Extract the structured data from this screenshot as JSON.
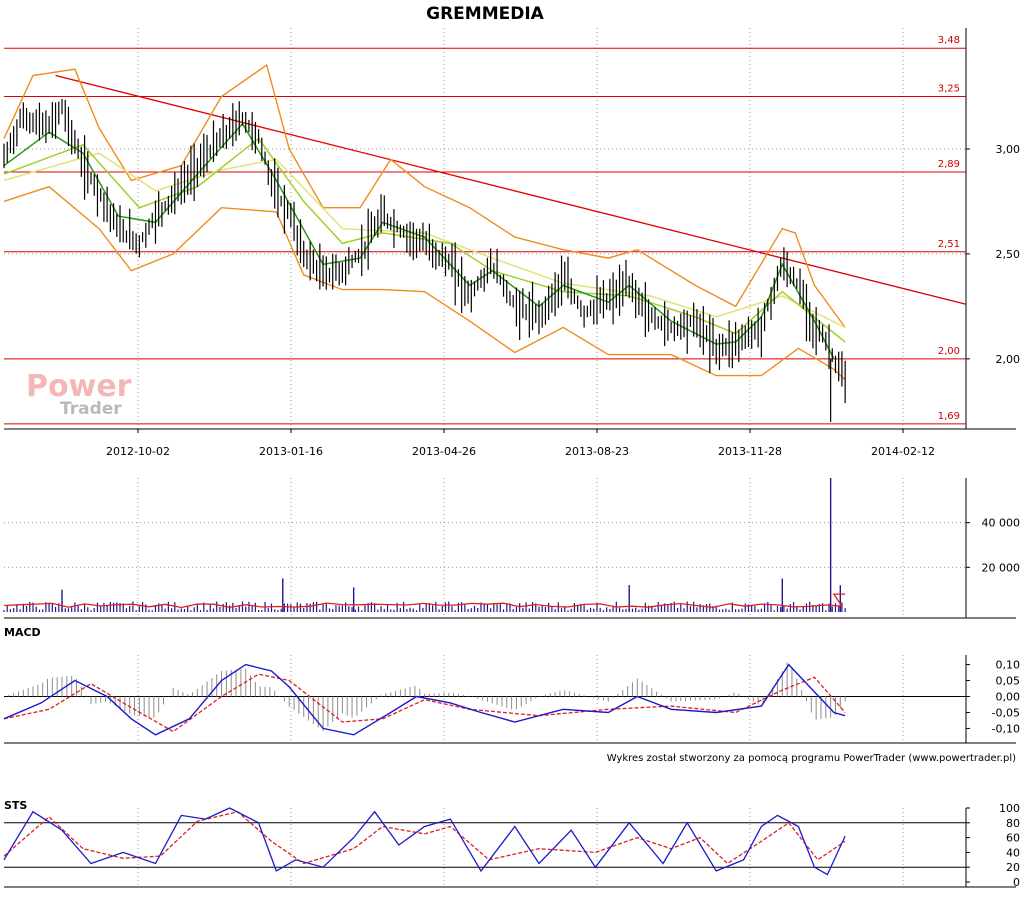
{
  "title": "GREMMEDIA",
  "footer": "Wykres został stworzony za pomocą programu PowerTrader (www.powertrader.pl)",
  "watermark": {
    "line1": "Power",
    "line2": "Trader"
  },
  "colors": {
    "candles": "#000000",
    "levels": "#dd0000",
    "trendline": "#dd0000",
    "bollinger": "#f08c1e",
    "ma_fast": "#2a9a18",
    "ma_mid": "#9fd02c",
    "ma_slow": "#e2e27a",
    "volume_bars": "#1a1a8c",
    "volume_ma": "#e02020",
    "macd_line": "#1a1acc",
    "macd_signal": "#dd2020",
    "macd_hist": "#8c8c8c",
    "sts_k": "#1a1acc",
    "sts_d": "#dd2020",
    "grid": "#999999"
  },
  "chart_data": [
    {
      "type": "candlestick",
      "name": "price",
      "title": "GREMMEDIA",
      "x_tick_labels": [
        "2012-10-02",
        "2013-01-16",
        "2013-04-26",
        "2013-08-23",
        "2013-11-28",
        "2014-02-12"
      ],
      "y_tick_labels": [
        "3,00",
        "2,50",
        "2,00"
      ],
      "ylim": [
        1.68,
        3.5
      ],
      "xlim": [
        "2012-07-23",
        "2014-03-12"
      ],
      "horizontal_levels": [
        {
          "label": "3,48",
          "value": 3.48
        },
        {
          "label": "3,25",
          "value": 3.25
        },
        {
          "label": "2,89",
          "value": 2.89
        },
        {
          "label": "2,51",
          "value": 2.51
        },
        {
          "label": "2,00",
          "value": 2.0
        },
        {
          "label": "1,69",
          "value": 1.69
        }
      ],
      "trendline": {
        "from": {
          "x": "2012-08-24",
          "y": 3.35
        },
        "to": {
          "x": "2014-03-12",
          "y": 2.26
        }
      },
      "price_path": [
        [
          "2012-07-23",
          2.95
        ],
        [
          "2012-08-03",
          3.15
        ],
        [
          "2012-08-20",
          3.1
        ],
        [
          "2012-08-28",
          3.2
        ],
        [
          "2012-09-10",
          2.92
        ],
        [
          "2012-09-20",
          2.8
        ],
        [
          "2012-10-02",
          2.62
        ],
        [
          "2012-10-15",
          2.55
        ],
        [
          "2012-10-25",
          2.68
        ],
        [
          "2012-11-08",
          2.8
        ],
        [
          "2012-11-20",
          2.92
        ],
        [
          "2012-12-05",
          3.05
        ],
        [
          "2012-12-18",
          3.15
        ],
        [
          "2012-12-28",
          3.05
        ],
        [
          "2013-01-08",
          2.78
        ],
        [
          "2013-01-16",
          2.7
        ],
        [
          "2013-01-25",
          2.5
        ],
        [
          "2013-02-06",
          2.4
        ],
        [
          "2013-02-18",
          2.42
        ],
        [
          "2013-03-01",
          2.5
        ],
        [
          "2013-03-15",
          2.68
        ],
        [
          "2013-03-28",
          2.6
        ],
        [
          "2013-04-10",
          2.55
        ],
        [
          "2013-04-26",
          2.45
        ],
        [
          "2013-05-08",
          2.3
        ],
        [
          "2013-05-22",
          2.45
        ],
        [
          "2013-06-05",
          2.25
        ],
        [
          "2013-06-20",
          2.2
        ],
        [
          "2013-07-05",
          2.38
        ],
        [
          "2013-07-18",
          2.22
        ],
        [
          "2013-08-02",
          2.28
        ],
        [
          "2013-08-15",
          2.35
        ],
        [
          "2013-08-28",
          2.2
        ],
        [
          "2013-09-10",
          2.15
        ],
        [
          "2013-09-25",
          2.18
        ],
        [
          "2013-10-08",
          2.05
        ],
        [
          "2013-10-20",
          2.08
        ],
        [
          "2013-11-05",
          2.15
        ],
        [
          "2013-11-18",
          2.45
        ],
        [
          "2013-11-28",
          2.35
        ],
        [
          "2013-12-08",
          2.15
        ],
        [
          "2013-12-16",
          2.08
        ],
        [
          "2013-12-20",
          2.0
        ],
        [
          "2013-12-27",
          1.88
        ]
      ],
      "moving_average_fast": [
        [
          "2012-07-23",
          2.92
        ],
        [
          "2012-08-20",
          3.08
        ],
        [
          "2012-09-10",
          2.98
        ],
        [
          "2012-10-02",
          2.68
        ],
        [
          "2012-10-25",
          2.65
        ],
        [
          "2012-11-20",
          2.88
        ],
        [
          "2012-12-18",
          3.12
        ],
        [
          "2013-01-08",
          2.85
        ],
        [
          "2013-02-06",
          2.45
        ],
        [
          "2013-03-01",
          2.48
        ],
        [
          "2013-03-15",
          2.65
        ],
        [
          "2013-04-10",
          2.58
        ],
        [
          "2013-05-08",
          2.35
        ],
        [
          "2013-05-22",
          2.42
        ],
        [
          "2013-06-20",
          2.25
        ],
        [
          "2013-07-05",
          2.35
        ],
        [
          "2013-08-02",
          2.27
        ],
        [
          "2013-08-15",
          2.35
        ],
        [
          "2013-09-10",
          2.18
        ],
        [
          "2013-10-08",
          2.07
        ],
        [
          "2013-10-20",
          2.08
        ],
        [
          "2013-11-05",
          2.2
        ],
        [
          "2013-11-18",
          2.45
        ],
        [
          "2013-12-08",
          2.18
        ],
        [
          "2013-12-20",
          2.0
        ]
      ],
      "moving_average_mid": [
        [
          "2012-07-23",
          2.88
        ],
        [
          "2012-09-10",
          3.02
        ],
        [
          "2012-10-15",
          2.72
        ],
        [
          "2012-11-20",
          2.82
        ],
        [
          "2012-12-28",
          3.05
        ],
        [
          "2013-01-25",
          2.75
        ],
        [
          "2013-02-18",
          2.55
        ],
        [
          "2013-03-15",
          2.6
        ],
        [
          "2013-04-26",
          2.55
        ],
        [
          "2013-05-22",
          2.42
        ],
        [
          "2013-07-05",
          2.32
        ],
        [
          "2013-08-15",
          2.3
        ],
        [
          "2013-09-25",
          2.2
        ],
        [
          "2013-10-20",
          2.12
        ],
        [
          "2013-11-18",
          2.32
        ],
        [
          "2013-12-27",
          2.08
        ]
      ],
      "moving_average_slow": [
        [
          "2012-07-23",
          2.85
        ],
        [
          "2012-09-20",
          2.98
        ],
        [
          "2012-10-25",
          2.8
        ],
        [
          "2012-12-05",
          2.9
        ],
        [
          "2013-01-08",
          2.95
        ],
        [
          "2013-02-18",
          2.62
        ],
        [
          "2013-04-10",
          2.6
        ],
        [
          "2013-05-22",
          2.48
        ],
        [
          "2013-07-05",
          2.36
        ],
        [
          "2013-08-28",
          2.3
        ],
        [
          "2013-10-08",
          2.2
        ],
        [
          "2013-11-18",
          2.3
        ],
        [
          "2013-12-27",
          2.15
        ]
      ],
      "bollinger_upper": [
        [
          "2012-07-23",
          3.05
        ],
        [
          "2012-08-10",
          3.35
        ],
        [
          "2012-09-05",
          3.38
        ],
        [
          "2012-09-20",
          3.1
        ],
        [
          "2012-10-10",
          2.85
        ],
        [
          "2012-11-10",
          2.92
        ],
        [
          "2012-12-05",
          3.25
        ],
        [
          "2013-01-02",
          3.4
        ],
        [
          "2013-01-16",
          3.0
        ],
        [
          "2013-02-06",
          2.72
        ],
        [
          "2013-03-01",
          2.72
        ],
        [
          "2013-03-20",
          2.95
        ],
        [
          "2013-04-10",
          2.82
        ],
        [
          "2013-05-08",
          2.72
        ],
        [
          "2013-06-05",
          2.58
        ],
        [
          "2013-07-05",
          2.52
        ],
        [
          "2013-08-02",
          2.48
        ],
        [
          "2013-08-20",
          2.52
        ],
        [
          "2013-09-25",
          2.35
        ],
        [
          "2013-10-20",
          2.25
        ],
        [
          "2013-11-18",
          2.62
        ],
        [
          "2013-11-26",
          2.6
        ],
        [
          "2013-12-08",
          2.35
        ],
        [
          "2013-12-27",
          2.15
        ]
      ],
      "bollinger_lower": [
        [
          "2012-07-23",
          2.75
        ],
        [
          "2012-08-20",
          2.82
        ],
        [
          "2012-09-20",
          2.62
        ],
        [
          "2012-10-10",
          2.42
        ],
        [
          "2012-11-05",
          2.5
        ],
        [
          "2012-12-05",
          2.72
        ],
        [
          "2013-01-08",
          2.7
        ],
        [
          "2013-01-25",
          2.4
        ],
        [
          "2013-02-18",
          2.33
        ],
        [
          "2013-03-15",
          2.33
        ],
        [
          "2013-04-10",
          2.32
        ],
        [
          "2013-05-08",
          2.18
        ],
        [
          "2013-06-05",
          2.03
        ],
        [
          "2013-07-05",
          2.15
        ],
        [
          "2013-08-02",
          2.02
        ],
        [
          "2013-09-10",
          2.02
        ],
        [
          "2013-10-08",
          1.92
        ],
        [
          "2013-11-05",
          1.92
        ],
        [
          "2013-11-28",
          2.05
        ],
        [
          "2013-12-20",
          1.95
        ],
        [
          "2013-12-27",
          1.9
        ]
      ],
      "last_candle_low": 1.7
    },
    {
      "type": "bar",
      "name": "volume",
      "y_tick_labels": [
        "40 000",
        "20 000"
      ],
      "ylim": [
        0,
        60000
      ],
      "spikes": [
        {
          "x": "2012-08-28",
          "value": 10000
        },
        {
          "x": "2013-01-12",
          "value": 15000
        },
        {
          "x": "2013-02-25",
          "value": 11000
        },
        {
          "x": "2013-08-15",
          "value": 12000
        },
        {
          "x": "2013-11-18",
          "value": 15000
        },
        {
          "x": "2013-12-18",
          "value": 60000
        },
        {
          "x": "2013-12-24",
          "value": 12000
        }
      ],
      "typical_level": 2500,
      "volume_ma_level": 8000
    },
    {
      "type": "line",
      "name": "MACD",
      "title": "MACD",
      "y_tick_labels": [
        "0,10",
        "0,05",
        "0,00",
        "-0,05",
        "-0,10"
      ],
      "ylim": [
        -0.13,
        0.13
      ],
      "macd": [
        [
          "2012-07-23",
          -0.07
        ],
        [
          "2012-08-15",
          -0.02
        ],
        [
          "2012-09-05",
          0.05
        ],
        [
          "2012-09-25",
          0.0
        ],
        [
          "2012-10-10",
          -0.07
        ],
        [
          "2012-10-25",
          -0.12
        ],
        [
          "2012-11-15",
          -0.07
        ],
        [
          "2012-12-05",
          0.05
        ],
        [
          "2012-12-20",
          0.1
        ],
        [
          "2013-01-05",
          0.08
        ],
        [
          "2013-01-16",
          0.03
        ],
        [
          "2013-02-06",
          -0.1
        ],
        [
          "2013-02-25",
          -0.12
        ],
        [
          "2013-03-20",
          -0.05
        ],
        [
          "2013-04-05",
          0.0
        ],
        [
          "2013-04-26",
          -0.02
        ],
        [
          "2013-05-15",
          -0.05
        ],
        [
          "2013-06-05",
          -0.08
        ],
        [
          "2013-07-05",
          -0.04
        ],
        [
          "2013-08-02",
          -0.05
        ],
        [
          "2013-08-20",
          0.0
        ],
        [
          "2013-09-10",
          -0.04
        ],
        [
          "2013-10-08",
          -0.05
        ],
        [
          "2013-11-05",
          -0.03
        ],
        [
          "2013-11-22",
          0.1
        ],
        [
          "2013-12-05",
          0.03
        ],
        [
          "2013-12-20",
          -0.05
        ],
        [
          "2013-12-27",
          -0.06
        ]
      ],
      "signal": [
        [
          "2012-07-23",
          -0.07
        ],
        [
          "2012-08-20",
          -0.04
        ],
        [
          "2012-09-15",
          0.04
        ],
        [
          "2012-10-05",
          -0.02
        ],
        [
          "2012-11-05",
          -0.11
        ],
        [
          "2012-12-05",
          0.0
        ],
        [
          "2012-12-28",
          0.07
        ],
        [
          "2013-01-16",
          0.05
        ],
        [
          "2013-02-18",
          -0.08
        ],
        [
          "2013-03-15",
          -0.07
        ],
        [
          "2013-04-10",
          -0.01
        ],
        [
          "2013-05-08",
          -0.04
        ],
        [
          "2013-06-20",
          -0.06
        ],
        [
          "2013-08-02",
          -0.04
        ],
        [
          "2013-09-10",
          -0.03
        ],
        [
          "2013-10-20",
          -0.05
        ],
        [
          "2013-11-18",
          0.02
        ],
        [
          "2013-12-08",
          0.06
        ],
        [
          "2013-12-27",
          -0.05
        ]
      ]
    },
    {
      "type": "line",
      "name": "STS",
      "title": "STS",
      "y_tick_labels": [
        "100",
        "80",
        "60",
        "40",
        "20",
        "0"
      ],
      "ylim": [
        0,
        100
      ],
      "reference_levels": [
        80,
        20
      ],
      "k": [
        [
          "2012-07-23",
          30
        ],
        [
          "2012-08-10",
          95
        ],
        [
          "2012-08-28",
          70
        ],
        [
          "2012-09-15",
          25
        ],
        [
          "2012-10-05",
          40
        ],
        [
          "2012-10-25",
          25
        ],
        [
          "2012-11-10",
          90
        ],
        [
          "2012-11-25",
          85
        ],
        [
          "2012-12-10",
          100
        ],
        [
          "2012-12-28",
          80
        ],
        [
          "2013-01-08",
          15
        ],
        [
          "2013-01-20",
          30
        ],
        [
          "2013-02-06",
          20
        ],
        [
          "2013-02-25",
          60
        ],
        [
          "2013-03-10",
          95
        ],
        [
          "2013-03-25",
          50
        ],
        [
          "2013-04-10",
          75
        ],
        [
          "2013-04-26",
          85
        ],
        [
          "2013-05-15",
          15
        ],
        [
          "2013-06-05",
          75
        ],
        [
          "2013-06-20",
          25
        ],
        [
          "2013-07-10",
          70
        ],
        [
          "2013-07-25",
          20
        ],
        [
          "2013-08-15",
          80
        ],
        [
          "2013-09-05",
          25
        ],
        [
          "2013-09-20",
          80
        ],
        [
          "2013-10-08",
          15
        ],
        [
          "2013-10-25",
          30
        ],
        [
          "2013-11-05",
          75
        ],
        [
          "2013-11-15",
          90
        ],
        [
          "2013-11-28",
          75
        ],
        [
          "2013-12-08",
          20
        ],
        [
          "2013-12-16",
          10
        ],
        [
          "2013-12-27",
          62
        ]
      ],
      "d": [
        [
          "2012-07-23",
          35
        ],
        [
          "2012-08-20",
          88
        ],
        [
          "2012-09-10",
          45
        ],
        [
          "2012-10-05",
          32
        ],
        [
          "2012-10-28",
          35
        ],
        [
          "2012-11-20",
          82
        ],
        [
          "2012-12-15",
          95
        ],
        [
          "2013-01-05",
          55
        ],
        [
          "2013-01-25",
          25
        ],
        [
          "2013-02-25",
          45
        ],
        [
          "2013-03-15",
          75
        ],
        [
          "2013-04-10",
          65
        ],
        [
          "2013-04-26",
          75
        ],
        [
          "2013-05-20",
          30
        ],
        [
          "2013-06-20",
          45
        ],
        [
          "2013-07-25",
          40
        ],
        [
          "2013-08-20",
          60
        ],
        [
          "2013-09-10",
          45
        ],
        [
          "2013-09-28",
          60
        ],
        [
          "2013-10-15",
          25
        ],
        [
          "2013-11-05",
          55
        ],
        [
          "2013-11-22",
          80
        ],
        [
          "2013-12-10",
          30
        ],
        [
          "2013-12-27",
          55
        ]
      ]
    }
  ]
}
